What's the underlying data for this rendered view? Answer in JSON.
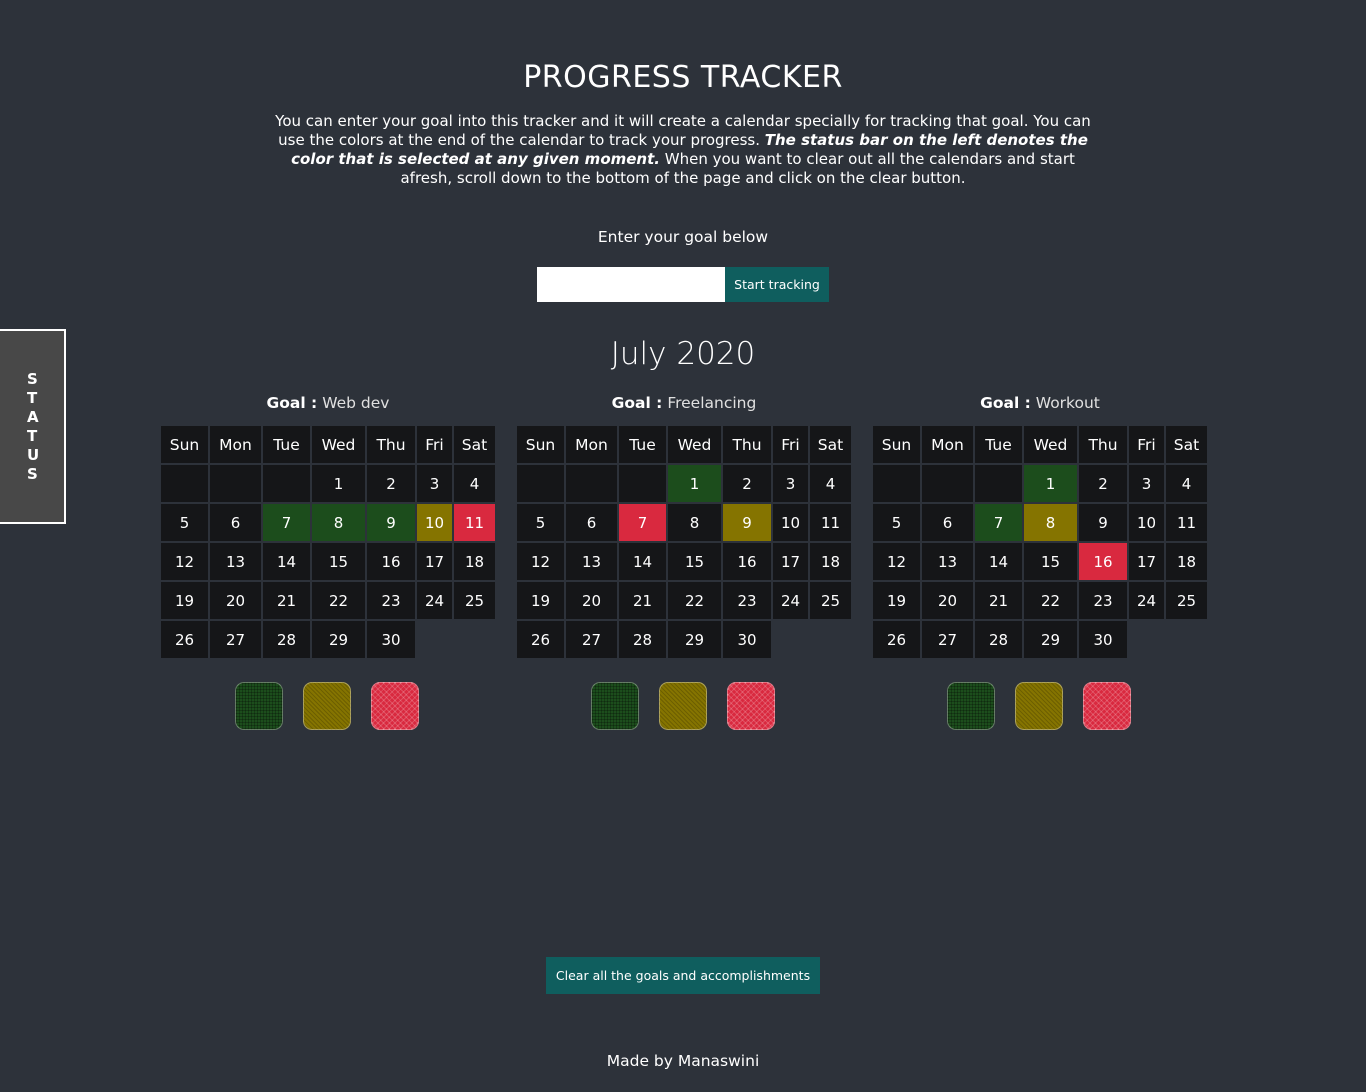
{
  "title": "PROGRESS TRACKER",
  "intro": {
    "part1": "You can enter your goal into this tracker and it will create a calendar specially for tracking that goal. You can use the colors at the end of the calendar to track your progress. ",
    "bold": "The status bar on the left denotes the color that is selected at any given moment.",
    "part2": " When you want to clear out all the calendars and start afresh, scroll down to the bottom of the page and click on the clear button."
  },
  "goal_prompt": "Enter your goal below",
  "goal_input": {
    "value": "",
    "placeholder": ""
  },
  "start_button": "Start tracking",
  "status_label": "STATUS",
  "month": "July 2020",
  "weekdays": [
    "Sun",
    "Mon",
    "Tue",
    "Wed",
    "Thu",
    "Fri",
    "Sat"
  ],
  "month_first_weekday": 3,
  "days_in_month": 30,
  "goal_prefix": "Goal :",
  "colors": {
    "green": "#1c4d1c",
    "yellow": "#857400",
    "red": "#d9293f",
    "accent": "#0f5e5e"
  },
  "calendars": [
    {
      "goal": "Web dev",
      "marks": {
        "7": "green",
        "8": "green",
        "9": "green",
        "10": "yellow",
        "11": "red"
      }
    },
    {
      "goal": "Freelancing",
      "marks": {
        "1": "green",
        "7": "red",
        "9": "yellow"
      }
    },
    {
      "goal": "Workout",
      "marks": {
        "1": "green",
        "7": "green",
        "8": "yellow",
        "16": "red"
      }
    }
  ],
  "swatch_order": [
    "green",
    "yellow",
    "red"
  ],
  "clear_button": "Clear all the goals and accomplishments",
  "footer": "Made by Manaswini"
}
